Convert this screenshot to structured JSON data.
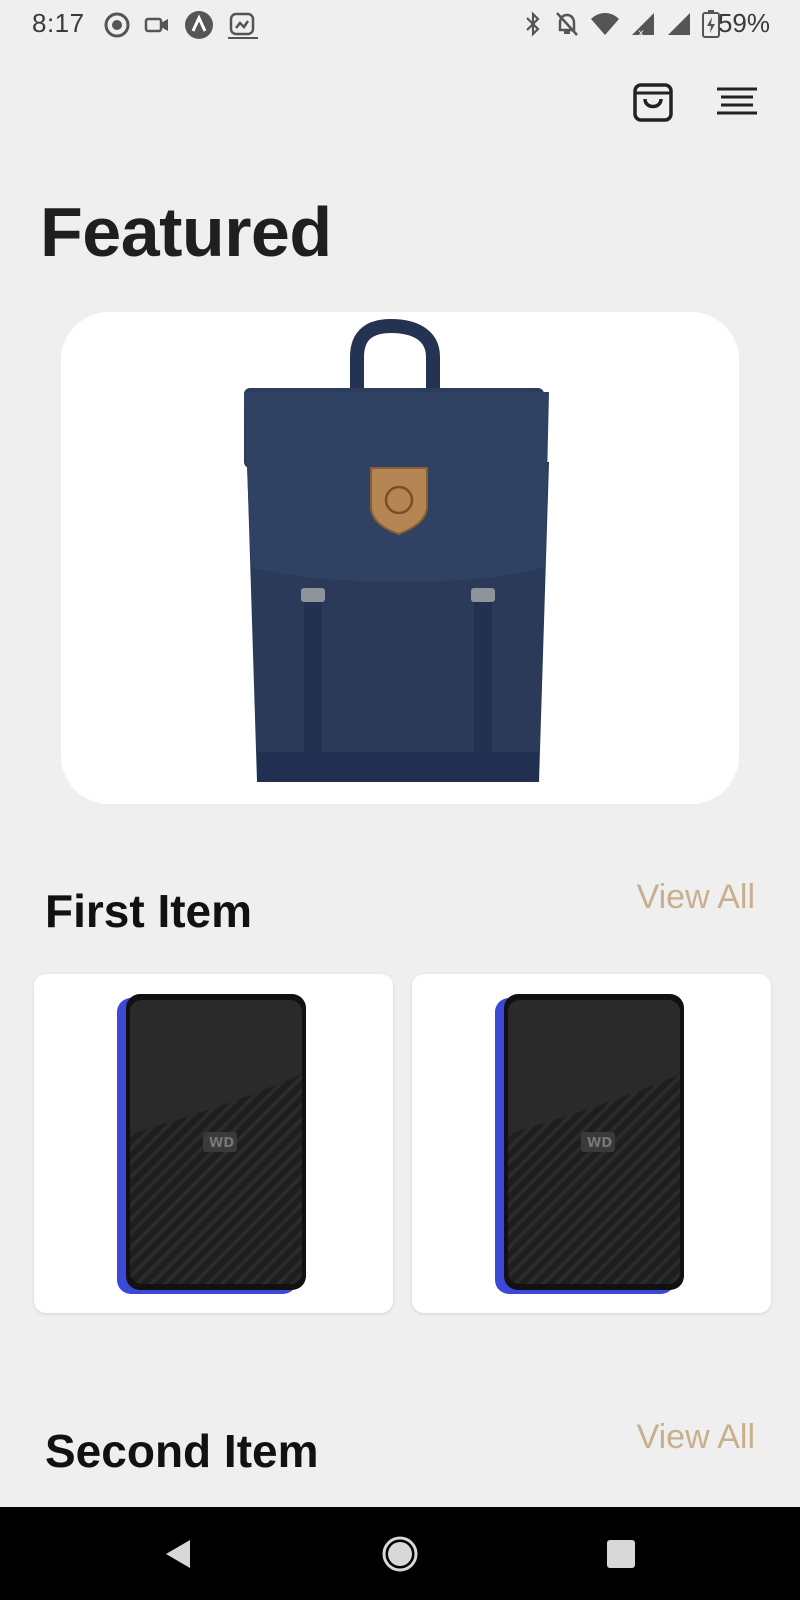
{
  "status_bar": {
    "time": "8:17",
    "battery": "59%",
    "left_icons": [
      "play-circle-icon",
      "video-camera-icon",
      "a-circle-icon",
      "screenshot-icon"
    ],
    "right_icons": [
      "bluetooth-icon",
      "notifications-off-icon",
      "wifi-icon",
      "signal-x-icon",
      "signal-icon",
      "battery-charging-icon"
    ]
  },
  "header": {
    "icons": [
      "shopping-bag-icon",
      "menu-icon"
    ]
  },
  "page": {
    "title": "Featured"
  },
  "featured": {
    "image": "navy-backpack"
  },
  "sections": [
    {
      "title": "First Item",
      "view_all": "View All",
      "products": [
        {
          "image": "wd-hard-drive"
        },
        {
          "image": "wd-hard-drive"
        }
      ]
    },
    {
      "title": "Second Item",
      "view_all": "View All"
    }
  ],
  "colors": {
    "accent": "#c8b08e",
    "background": "#efefef",
    "card": "#ffffff",
    "backpack": "#2a3a55",
    "drive_blue": "#3b49d6"
  },
  "nav_bar": {
    "icons": [
      "back-triangle-icon",
      "home-circle-icon",
      "recents-square-icon"
    ]
  }
}
